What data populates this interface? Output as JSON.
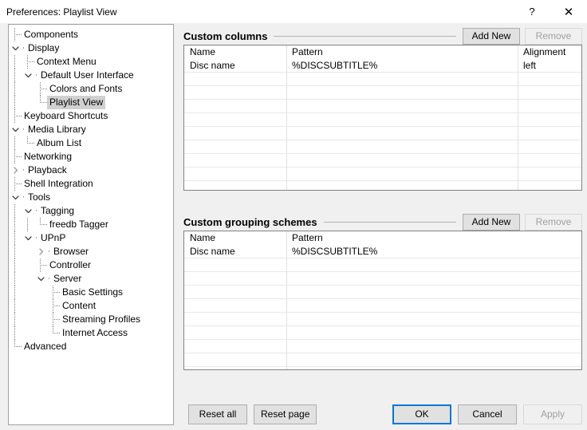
{
  "window": {
    "title": "Preferences: Playlist View",
    "help_icon": "question-mark-icon",
    "close_icon": "close-icon"
  },
  "tree": {
    "items": [
      {
        "label": "Components",
        "depth": 0,
        "expander": "none",
        "selected": false
      },
      {
        "label": "Display",
        "depth": 0,
        "expander": "expanded",
        "selected": false
      },
      {
        "label": "Context Menu",
        "depth": 1,
        "expander": "none",
        "selected": false
      },
      {
        "label": "Default User Interface",
        "depth": 1,
        "expander": "expanded",
        "selected": false
      },
      {
        "label": "Colors and Fonts",
        "depth": 2,
        "expander": "none",
        "selected": false
      },
      {
        "label": "Playlist View",
        "depth": 2,
        "expander": "none",
        "selected": true
      },
      {
        "label": "Keyboard Shortcuts",
        "depth": 0,
        "expander": "none",
        "selected": false
      },
      {
        "label": "Media Library",
        "depth": 0,
        "expander": "expanded",
        "selected": false
      },
      {
        "label": "Album List",
        "depth": 1,
        "expander": "none",
        "selected": false
      },
      {
        "label": "Networking",
        "depth": 0,
        "expander": "none",
        "selected": false
      },
      {
        "label": "Playback",
        "depth": 0,
        "expander": "collapsed",
        "selected": false
      },
      {
        "label": "Shell Integration",
        "depth": 0,
        "expander": "none",
        "selected": false
      },
      {
        "label": "Tools",
        "depth": 0,
        "expander": "expanded",
        "selected": false
      },
      {
        "label": "Tagging",
        "depth": 1,
        "expander": "expanded",
        "selected": false
      },
      {
        "label": "freedb Tagger",
        "depth": 2,
        "expander": "none",
        "selected": false
      },
      {
        "label": "UPnP",
        "depth": 1,
        "expander": "expanded",
        "selected": false
      },
      {
        "label": "Browser",
        "depth": 2,
        "expander": "collapsed",
        "selected": false
      },
      {
        "label": "Controller",
        "depth": 2,
        "expander": "none",
        "selected": false
      },
      {
        "label": "Server",
        "depth": 2,
        "expander": "expanded",
        "selected": false
      },
      {
        "label": "Basic Settings",
        "depth": 3,
        "expander": "none",
        "selected": false
      },
      {
        "label": "Content",
        "depth": 3,
        "expander": "none",
        "selected": false
      },
      {
        "label": "Streaming Profiles",
        "depth": 3,
        "expander": "none",
        "selected": false
      },
      {
        "label": "Internet Access",
        "depth": 3,
        "expander": "none",
        "selected": false
      },
      {
        "label": "Advanced",
        "depth": 0,
        "expander": "none",
        "selected": false
      }
    ]
  },
  "custom_columns": {
    "title": "Custom columns",
    "add_new_label": "Add New",
    "remove_label": "Remove",
    "remove_disabled": true,
    "headers": [
      "Name",
      "Pattern",
      "Alignment"
    ],
    "rows": [
      [
        "Disc name",
        "%DISCSUBTITLE%",
        "left"
      ]
    ],
    "empty_row_count": 9
  },
  "custom_grouping": {
    "title": "Custom grouping schemes",
    "add_new_label": "Add New",
    "remove_label": "Remove",
    "remove_disabled": true,
    "headers": [
      "Name",
      "Pattern"
    ],
    "rows": [
      [
        "Disc name",
        "%DISCSUBTITLE%"
      ]
    ],
    "empty_row_count": 8
  },
  "footer": {
    "reset_all_label": "Reset all",
    "reset_page_label": "Reset page",
    "ok_label": "OK",
    "cancel_label": "Cancel",
    "apply_label": "Apply",
    "apply_disabled": true
  },
  "colors": {
    "accent": "#0078d7",
    "window_bg": "#f0f0f0",
    "field_bg": "#ffffff",
    "selection": "#d0d0d0",
    "disabled_text": "#a0a0a0"
  }
}
